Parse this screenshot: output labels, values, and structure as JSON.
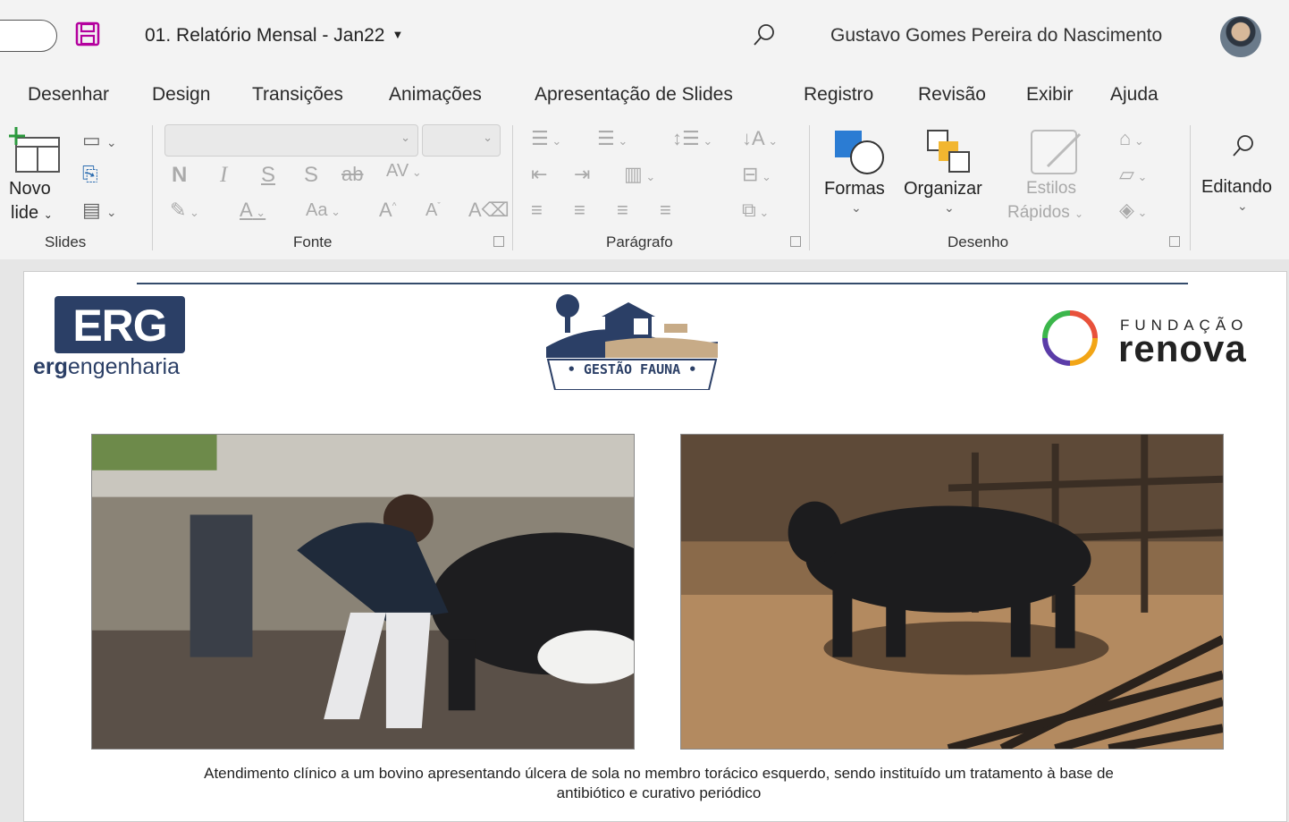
{
  "titlebar": {
    "document_title": "01. Relatório Mensal - Jan22",
    "user_name": "Gustavo Gomes Pereira do Nascimento"
  },
  "tabs": [
    "Desenhar",
    "Design",
    "Transições",
    "Animações",
    "Apresentação de Slides",
    "Registro",
    "Revisão",
    "Exibir",
    "Ajuda"
  ],
  "ribbon": {
    "slides": {
      "new_slide_line1": "Novo",
      "new_slide_line2": "lide",
      "label": "Slides"
    },
    "fonte": {
      "bold": "N",
      "italic": "I",
      "underline": "S",
      "shadow": "S",
      "strike": "ab",
      "spacing": "AV",
      "case": "Aa",
      "grow": "A",
      "shrink": "A",
      "label": "Fonte"
    },
    "paragrafo": {
      "label": "Parágrafo"
    },
    "desenho": {
      "shapes": "Formas",
      "arrange": "Organizar",
      "styles_line1": "Estilos",
      "styles_line2": "Rápidos",
      "label": "Desenho"
    },
    "editing": {
      "label": "Editando"
    }
  },
  "slide": {
    "erg_logo": "ERG",
    "erg_sub_bold": "erg",
    "erg_sub_rest": "engenharia",
    "gestao_fauna": "GESTÃO FAUNA",
    "fundacao": "FUNDAÇÃO",
    "renova": "renova",
    "caption_line1": "Atendimento clínico a um bovino apresentando úlcera de sola no membro torácico esquerdo, sendo instituído um tratamento à base de",
    "caption_line2": "antibiótico e curativo periódico"
  }
}
